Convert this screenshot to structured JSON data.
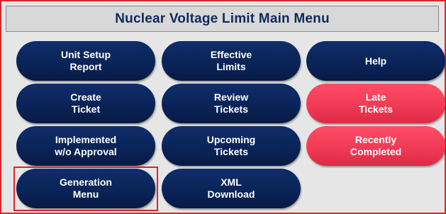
{
  "header": {
    "title": "Nuclear Voltage Limit Main Menu"
  },
  "colors": {
    "frame_border": "#d9262a",
    "button_navy": "#0a2458",
    "button_red": "#f23a55",
    "title_text": "#0e2a5c",
    "panel_bg": "#e6e6e6"
  },
  "menu": {
    "unit_setup_report": "Unit Setup\nReport",
    "effective_limits": "Effective\nLimits",
    "help": "Help",
    "create_ticket": "Create\nTicket",
    "review_tickets": "Review\nTickets",
    "late_tickets": "Late\nTickets",
    "implemented_wo_approval": "Implemented\nw/o Approval",
    "upcoming_tickets": "Upcoming\nTickets",
    "recently_completed": "Recently\nCompleted",
    "generation_menu": "Generation\nMenu",
    "xml_download": "XML\nDownload"
  }
}
